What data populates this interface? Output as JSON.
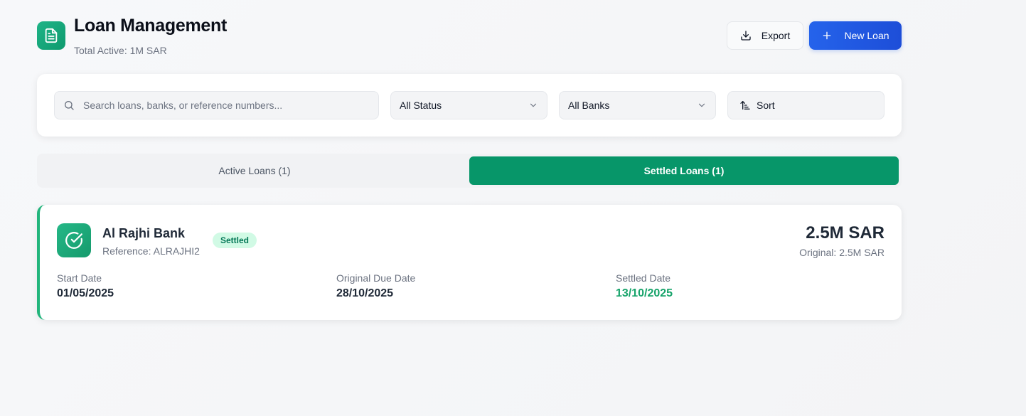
{
  "header": {
    "title": "Loan Management",
    "subtitle": "Total Active: 1M SAR",
    "export_label": "Export",
    "new_loan_label": "New Loan"
  },
  "filters": {
    "search_placeholder": "Search loans, banks, or reference numbers...",
    "status_selected": "All Status",
    "banks_selected": "All Banks",
    "sort_label": "Sort"
  },
  "tabs": [
    {
      "label": "Active Loans (1)",
      "active": false
    },
    {
      "label": "Settled Loans (1)",
      "active": true
    }
  ],
  "loans": [
    {
      "bank": "Al Rajhi Bank",
      "reference": "Reference: ALRAJHI2",
      "status": "Settled",
      "amount": "2.5M SAR",
      "original": "Original: 2.5M SAR",
      "fields": [
        {
          "label": "Start Date",
          "value": "01/05/2025"
        },
        {
          "label": "Original Due Date",
          "value": "28/10/2025"
        },
        {
          "label": "Settled Date",
          "value": "13/10/2025"
        }
      ]
    }
  ],
  "colors": {
    "brand_green": "#079669",
    "primary_blue": "#2563eb",
    "settled_text": "#16a36a",
    "badge_bg": "#d1fae5"
  },
  "icons": {
    "logo": "document-icon",
    "export": "download-icon",
    "new_loan": "plus-icon",
    "search": "search-icon",
    "select": "chevron-down-icon",
    "sort": "sort-icon",
    "loan_status": "check-circle-icon"
  }
}
